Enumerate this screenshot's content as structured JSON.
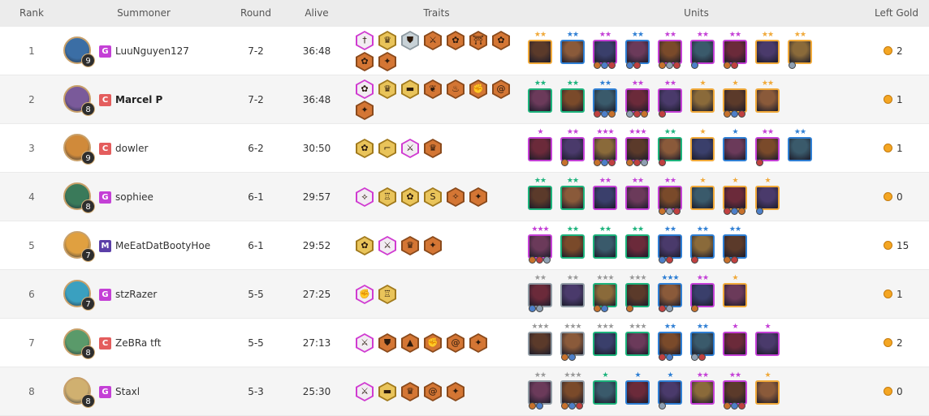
{
  "headers": {
    "rank": "Rank",
    "summoner": "Summoner",
    "round": "Round",
    "alive": "Alive",
    "traits": "Traits",
    "units": "Units",
    "left_gold": "Left Gold"
  },
  "colors": {
    "header_bg": "#ececec",
    "row_alt_bg": "#f5f5f5",
    "trait_bronze": "#d47634",
    "trait_gold": "#e9c45a",
    "trait_silver": "#c8d2d7",
    "trait_prismatic": "#d03bd1",
    "cost_1": "#8f9aa3",
    "cost_2": "#1db37c",
    "cost_3": "#2f7fd4",
    "cost_4": "#c440d6",
    "cost_5": "#f0a93a",
    "star_gray": "#999999",
    "star_green": "#1db37c",
    "star_blue": "#2f7fd4",
    "star_purple": "#c440d6",
    "star_gold": "#f0a93a",
    "region_g": "#c440d6",
    "region_c": "#e45d5d",
    "region_m": "#5b3fa8",
    "gold_coin": "#f4a623"
  },
  "players": [
    {
      "rank": "1",
      "summoner": "LuuNguyen127",
      "region": "G",
      "level": "9",
      "round": "7-2",
      "alive": "36:48",
      "gold": "2",
      "traits": [
        {
          "tier": "prismatic",
          "icon": "dagger-icon"
        },
        {
          "tier": "gold",
          "icon": "crown-icon"
        },
        {
          "tier": "silver",
          "icon": "shield-icon"
        },
        {
          "tier": "bronze",
          "icon": "crossed-swords-icon"
        },
        {
          "tier": "bronze",
          "icon": "flower-icon"
        },
        {
          "tier": "bronze",
          "icon": "gate-icon"
        },
        {
          "tier": "bronze",
          "icon": "flower-icon"
        },
        {
          "tier": "bronze",
          "icon": "flower-icon"
        },
        {
          "tier": "bronze",
          "icon": "shuriken-icon"
        }
      ],
      "units": [
        {
          "cost": 5,
          "stars": 2,
          "items": []
        },
        {
          "cost": 3,
          "stars": 2,
          "items": []
        },
        {
          "cost": 4,
          "stars": 2,
          "items": [
            "#c8722c",
            "#4d7fc9",
            "#c14040"
          ]
        },
        {
          "cost": 3,
          "stars": 2,
          "items": [
            "#4d7fc9",
            "#c14040"
          ]
        },
        {
          "cost": 4,
          "stars": 2,
          "items": [
            "#c8722c",
            "#8fa0b3",
            "#c14040"
          ]
        },
        {
          "cost": 4,
          "stars": 2,
          "items": [
            "#4d7fc9"
          ]
        },
        {
          "cost": 4,
          "stars": 2,
          "items": [
            "#c8722c",
            "#c14040"
          ]
        },
        {
          "cost": 5,
          "stars": 2,
          "items": []
        },
        {
          "cost": 5,
          "stars": 2,
          "items": [
            "#8fa0b3"
          ]
        }
      ]
    },
    {
      "rank": "2",
      "summoner": "Marcel P",
      "region": "C",
      "level": "8",
      "round": "7-2",
      "alive": "36:48",
      "gold": "1",
      "traits": [
        {
          "tier": "prismatic",
          "icon": "flower-icon"
        },
        {
          "tier": "gold",
          "icon": "crown-icon"
        },
        {
          "tier": "gold",
          "icon": "anvil-icon"
        },
        {
          "tier": "bronze",
          "icon": "leaf-icon"
        },
        {
          "tier": "bronze",
          "icon": "flame-icon"
        },
        {
          "tier": "bronze",
          "icon": "fist-icon"
        },
        {
          "tier": "bronze",
          "icon": "swirl-icon"
        },
        {
          "tier": "bronze",
          "icon": "shuriken-icon"
        }
      ],
      "units": [
        {
          "cost": 2,
          "stars": 2,
          "items": []
        },
        {
          "cost": 2,
          "stars": 2,
          "items": []
        },
        {
          "cost": 3,
          "stars": 2,
          "items": [
            "#c14040",
            "#4d7fc9",
            "#c8722c"
          ]
        },
        {
          "cost": 4,
          "stars": 2,
          "items": [
            "#8fa0b3",
            "#c14040",
            "#c8722c"
          ]
        },
        {
          "cost": 4,
          "stars": 2,
          "items": [
            "#c14040"
          ]
        },
        {
          "cost": 5,
          "stars": 1,
          "items": []
        },
        {
          "cost": 5,
          "stars": 1,
          "items": [
            "#c8722c",
            "#4d7fc9",
            "#c14040"
          ]
        },
        {
          "cost": 5,
          "stars": 2,
          "items": []
        }
      ]
    },
    {
      "rank": "3",
      "summoner": "dowler",
      "region": "C",
      "level": "9",
      "round": "6-2",
      "alive": "30:50",
      "gold": "1",
      "traits": [
        {
          "tier": "gold",
          "icon": "flower-icon"
        },
        {
          "tier": "gold",
          "icon": "boot-icon"
        },
        {
          "tier": "prismatic",
          "icon": "sword-icon"
        },
        {
          "tier": "bronze",
          "icon": "crown-icon"
        }
      ],
      "units": [
        {
          "cost": 4,
          "stars": 1,
          "items": []
        },
        {
          "cost": 4,
          "stars": 2,
          "items": [
            "#c8722c"
          ]
        },
        {
          "cost": 4,
          "stars": 3,
          "items": [
            "#c8722c",
            "#4d7fc9",
            "#c14040"
          ]
        },
        {
          "cost": 4,
          "stars": 3,
          "items": [
            "#c8722c",
            "#c14040",
            "#8fa0b3"
          ]
        },
        {
          "cost": 2,
          "stars": 2,
          "items": [
            "#c14040"
          ]
        },
        {
          "cost": 5,
          "stars": 1,
          "items": []
        },
        {
          "cost": 3,
          "stars": 1,
          "items": []
        },
        {
          "cost": 4,
          "stars": 2,
          "items": [
            "#c14040"
          ]
        },
        {
          "cost": 3,
          "stars": 2,
          "items": []
        }
      ]
    },
    {
      "rank": "4",
      "summoner": "sophiee",
      "region": "G",
      "level": "8",
      "round": "6-1",
      "alive": "29:57",
      "gold": "0",
      "traits": [
        {
          "tier": "prismatic",
          "icon": "wing-icon"
        },
        {
          "tier": "gold",
          "icon": "trophy-icon"
        },
        {
          "tier": "gold",
          "icon": "flower-icon"
        },
        {
          "tier": "gold",
          "icon": "serpent-icon"
        },
        {
          "tier": "bronze",
          "icon": "claw-icon"
        },
        {
          "tier": "bronze",
          "icon": "shuriken-icon"
        }
      ],
      "units": [
        {
          "cost": 2,
          "stars": 2,
          "items": []
        },
        {
          "cost": 2,
          "stars": 2,
          "items": []
        },
        {
          "cost": 4,
          "stars": 2,
          "items": []
        },
        {
          "cost": 4,
          "stars": 2,
          "items": []
        },
        {
          "cost": 4,
          "stars": 2,
          "items": [
            "#c8722c",
            "#8fa0b3",
            "#c14040"
          ]
        },
        {
          "cost": 5,
          "stars": 1,
          "items": []
        },
        {
          "cost": 5,
          "stars": 1,
          "items": [
            "#c14040",
            "#4d7fc9",
            "#c8722c"
          ]
        },
        {
          "cost": 5,
          "stars": 1,
          "items": [
            "#4d7fc9"
          ]
        }
      ]
    },
    {
      "rank": "5",
      "summoner": "MeEatDatBootyHoe",
      "region": "M",
      "level": "7",
      "round": "6-1",
      "alive": "29:52",
      "gold": "15",
      "traits": [
        {
          "tier": "gold",
          "icon": "flower-icon"
        },
        {
          "tier": "prismatic",
          "icon": "sword-icon"
        },
        {
          "tier": "bronze",
          "icon": "crown-icon"
        },
        {
          "tier": "bronze",
          "icon": "shuriken-icon"
        }
      ],
      "units": [
        {
          "cost": 4,
          "stars": 3,
          "items": [
            "#c8722c",
            "#c14040",
            "#8fa0b3"
          ]
        },
        {
          "cost": 2,
          "stars": 2,
          "items": []
        },
        {
          "cost": 2,
          "stars": 2,
          "items": []
        },
        {
          "cost": 2,
          "stars": 2,
          "items": []
        },
        {
          "cost": 3,
          "stars": 2,
          "items": [
            "#4d7fc9",
            "#c14040"
          ]
        },
        {
          "cost": 3,
          "stars": 2,
          "items": [
            "#c14040"
          ]
        },
        {
          "cost": 3,
          "stars": 2,
          "items": [
            "#c8722c",
            "#c14040"
          ]
        }
      ]
    },
    {
      "rank": "6",
      "summoner": "stzRazer",
      "region": "G",
      "level": "7",
      "round": "5-5",
      "alive": "27:25",
      "gold": "1",
      "traits": [
        {
          "tier": "prismatic",
          "icon": "fist-icon"
        },
        {
          "tier": "gold",
          "icon": "trophy-icon"
        }
      ],
      "units": [
        {
          "cost": 1,
          "stars": 2,
          "items": [
            "#4d7fc9",
            "#8fa0b3"
          ]
        },
        {
          "cost": 1,
          "stars": 2,
          "items": []
        },
        {
          "cost": 2,
          "stars": 3,
          "items": [
            "#c8722c",
            "#4d7fc9"
          ]
        },
        {
          "cost": 2,
          "stars": 3,
          "items": [
            "#c8722c"
          ]
        },
        {
          "cost": 3,
          "stars": 3,
          "items": [
            "#c14040",
            "#8fa0b3"
          ]
        },
        {
          "cost": 4,
          "stars": 2,
          "items": [
            "#c8722c"
          ]
        },
        {
          "cost": 5,
          "stars": 1,
          "items": []
        }
      ]
    },
    {
      "rank": "7",
      "summoner": "ZeBRa tft",
      "region": "C",
      "level": "8",
      "round": "5-5",
      "alive": "27:13",
      "gold": "2",
      "traits": [
        {
          "tier": "prismatic",
          "icon": "crossed-swords-icon"
        },
        {
          "tier": "bronze",
          "icon": "shield-icon"
        },
        {
          "tier": "bronze",
          "icon": "mountain-icon"
        },
        {
          "tier": "bronze",
          "icon": "fist-icon"
        },
        {
          "tier": "bronze",
          "icon": "swirl-icon"
        },
        {
          "tier": "bronze",
          "icon": "shuriken-icon"
        }
      ],
      "units": [
        {
          "cost": 1,
          "stars": 3,
          "items": []
        },
        {
          "cost": 1,
          "stars": 3,
          "items": [
            "#c8722c",
            "#4d7fc9"
          ]
        },
        {
          "cost": 2,
          "stars": 3,
          "items": []
        },
        {
          "cost": 2,
          "stars": 3,
          "items": []
        },
        {
          "cost": 3,
          "stars": 2,
          "items": [
            "#c14040",
            "#4d7fc9"
          ]
        },
        {
          "cost": 3,
          "stars": 2,
          "items": [
            "#8fa0b3",
            "#c14040"
          ]
        },
        {
          "cost": 4,
          "stars": 1,
          "items": []
        },
        {
          "cost": 4,
          "stars": 1,
          "items": []
        }
      ]
    },
    {
      "rank": "8",
      "summoner": "Staxl",
      "region": "G",
      "level": "8",
      "round": "5-3",
      "alive": "25:30",
      "gold": "0",
      "traits": [
        {
          "tier": "prismatic",
          "icon": "crossed-swords-icon"
        },
        {
          "tier": "gold",
          "icon": "anvil-icon"
        },
        {
          "tier": "bronze",
          "icon": "crown-icon"
        },
        {
          "tier": "bronze",
          "icon": "swirl-icon"
        },
        {
          "tier": "bronze",
          "icon": "shuriken-icon"
        }
      ],
      "units": [
        {
          "cost": 1,
          "stars": 2,
          "items": [
            "#c8722c",
            "#4d7fc9"
          ]
        },
        {
          "cost": 1,
          "stars": 3,
          "items": [
            "#c8722c",
            "#4d7fc9",
            "#c14040"
          ]
        },
        {
          "cost": 2,
          "stars": 1,
          "items": []
        },
        {
          "cost": 3,
          "stars": 1,
          "items": []
        },
        {
          "cost": 3,
          "stars": 1,
          "items": [
            "#8fa0b3"
          ]
        },
        {
          "cost": 4,
          "stars": 2,
          "items": []
        },
        {
          "cost": 4,
          "stars": 2,
          "items": [
            "#c8722c",
            "#4d7fc9",
            "#c14040"
          ]
        },
        {
          "cost": 5,
          "stars": 1,
          "items": []
        }
      ]
    }
  ]
}
